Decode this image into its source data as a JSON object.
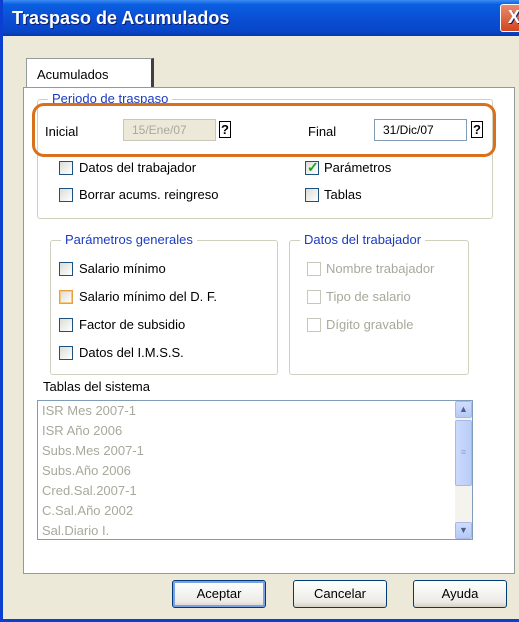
{
  "window": {
    "title": "Traspaso de Acumulados",
    "close_glyph": "X"
  },
  "tab": {
    "label": "Acumulados"
  },
  "periodo": {
    "legend": "Periodo de traspaso",
    "inicial_label": "Inicial",
    "inicial_value": "15/Ene/07",
    "final_label": "Final",
    "final_value": "31/Dic/07",
    "help_glyph": "?"
  },
  "options": {
    "datos_trabajador": "Datos del trabajador",
    "borrar_acums": "Borrar acums. reingreso",
    "parametros": "Parámetros",
    "tablas": "Tablas"
  },
  "parametros_generales": {
    "legend": "Parámetros generales",
    "items": [
      "Salario mínimo",
      "Salario mínimo del D. F.",
      "Factor de subsidio",
      "Datos del I.M.S.S."
    ]
  },
  "datos_trabajador_group": {
    "legend": "Datos del trabajador",
    "items": [
      "Nombre trabajador",
      "Tipo de salario",
      "Dígito gravable"
    ]
  },
  "tablas_sistema": {
    "label": "Tablas del sistema",
    "items": [
      "ISR Mes 2007-1",
      "ISR Año 2006",
      "Subs.Mes 2007-1",
      "Subs.Año 2006",
      "Cred.Sal.2007-1",
      "C.Sal.Año 2002",
      "Sal.Diario I."
    ]
  },
  "buttons": {
    "aceptar": "Aceptar",
    "cancelar": "Cancelar",
    "ayuda": "Ayuda"
  },
  "icons": {
    "check": "✓",
    "scroll_up": "▲",
    "scroll_down": "▼",
    "grip": "≡"
  }
}
